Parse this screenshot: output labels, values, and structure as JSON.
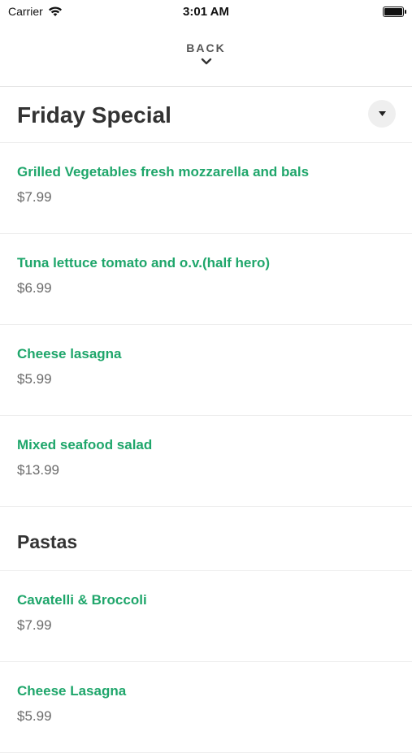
{
  "status": {
    "carrier": "Carrier",
    "time": "3:01 AM"
  },
  "nav": {
    "back_label": "BACK"
  },
  "sections": [
    {
      "title": "Friday Special",
      "items": [
        {
          "name": "Grilled Vegetables fresh mozzarella and bals",
          "price": "$7.99"
        },
        {
          "name": "Tuna lettuce tomato and o.v.(half hero)",
          "price": "$6.99"
        },
        {
          "name": "Cheese lasagna",
          "price": "$5.99"
        },
        {
          "name": "Mixed seafood salad",
          "price": "$13.99"
        }
      ]
    },
    {
      "title": "Pastas",
      "items": [
        {
          "name": "Cavatelli & Broccoli",
          "price": "$7.99"
        },
        {
          "name": "Cheese Lasagna",
          "price": "$5.99"
        }
      ]
    }
  ],
  "colors": {
    "accent_green": "#1fa66b",
    "price_gray": "#6b6b6b",
    "title_dark": "#333333"
  },
  "icons": {
    "wifi": "wifi-icon",
    "battery": "battery-icon",
    "back": "chevron-down-icon",
    "dropdown": "caret-down-icon"
  }
}
